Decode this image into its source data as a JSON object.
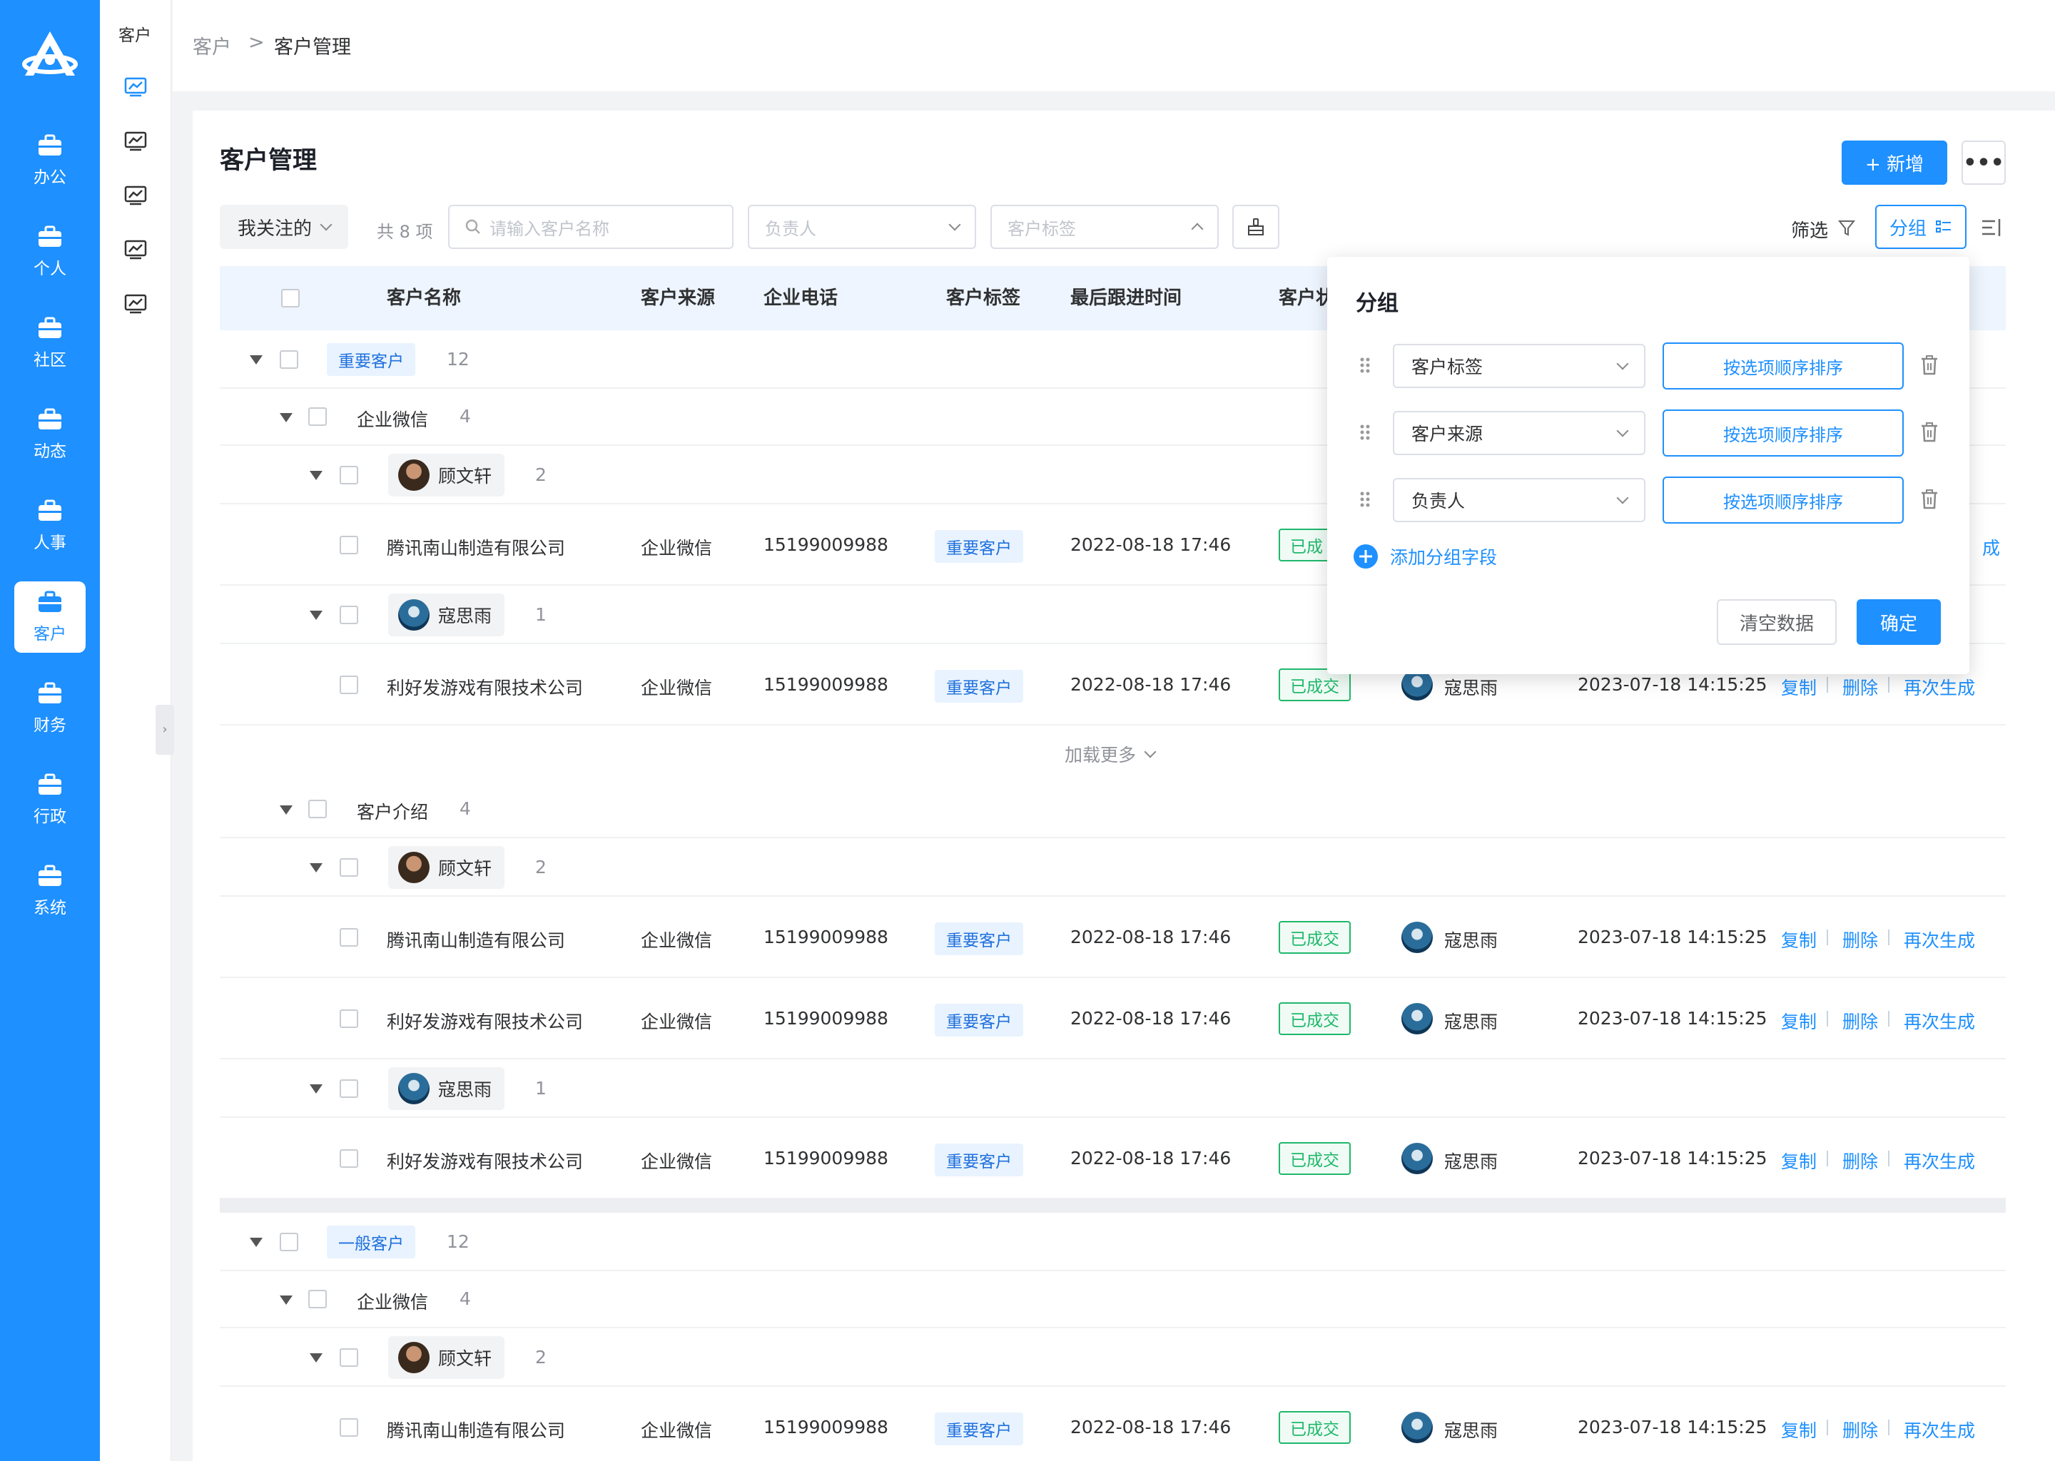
{
  "nav": {
    "items": [
      {
        "label": "办公"
      },
      {
        "label": "个人"
      },
      {
        "label": "社区"
      },
      {
        "label": "动态"
      },
      {
        "label": "人事"
      },
      {
        "label": "客户"
      },
      {
        "label": "财务"
      },
      {
        "label": "行政"
      },
      {
        "label": "系统"
      }
    ],
    "active": "客户"
  },
  "subnav": {
    "title": "客户"
  },
  "breadcrumb": {
    "parent": "客户",
    "separator": ">",
    "current": "客户管理"
  },
  "page": {
    "title": "客户管理",
    "add_label": "+ 新增",
    "more_label": "•••"
  },
  "toolbar": {
    "follow_label": "我关注的",
    "count_label": "共 8 项",
    "search_placeholder": "请输入客户名称",
    "owner_placeholder": "负责人",
    "tag_placeholder": "客户标签",
    "filter_label": "筛选",
    "group_label": "分组"
  },
  "columns": [
    "客户名称",
    "客户来源",
    "企业电话",
    "客户标签",
    "最后跟进时间",
    "客户状"
  ],
  "table": {
    "groups": {
      "important": {
        "label": "重要客户",
        "count": "12"
      },
      "normal": {
        "label": "一般客户",
        "count": "12"
      }
    },
    "sources": {
      "wechat": {
        "label": "企业微信",
        "count": "4"
      },
      "intro": {
        "label": "客户介绍",
        "count": "4"
      }
    },
    "people": {
      "gu": {
        "name": "顾文轩",
        "count": "2"
      },
      "kou": {
        "name": "寇思雨",
        "count": "1"
      }
    },
    "companies": {
      "a": "腾讯南山制造有限公司",
      "b": "利好发游戏有限技术公司"
    },
    "source_value": "企业微信",
    "phone": "15199009988",
    "tag": "重要客户",
    "last_follow": "2022-08-18 17:46",
    "status": "已成交",
    "status_partial": "已成",
    "owner": "寇思雨",
    "created": "2023-07-18 14:15:25",
    "actions": {
      "copy": "复制",
      "delete": "删除",
      "regen": "再次生成",
      "regen_partial": "成"
    },
    "load_more": "加载更多"
  },
  "popover": {
    "title": "分组",
    "fields": [
      {
        "field": "客户标签",
        "sort": "按选项顺序排序"
      },
      {
        "field": "客户来源",
        "sort": "按选项顺序排序"
      },
      {
        "field": "负责人",
        "sort": "按选项顺序排序"
      }
    ],
    "add_label": "添加分组字段",
    "clear_label": "清空数据",
    "confirm_label": "确定"
  },
  "colors": {
    "primary": "#1e90ff",
    "success": "#1fb86b",
    "header_bg": "#eef5fe"
  }
}
